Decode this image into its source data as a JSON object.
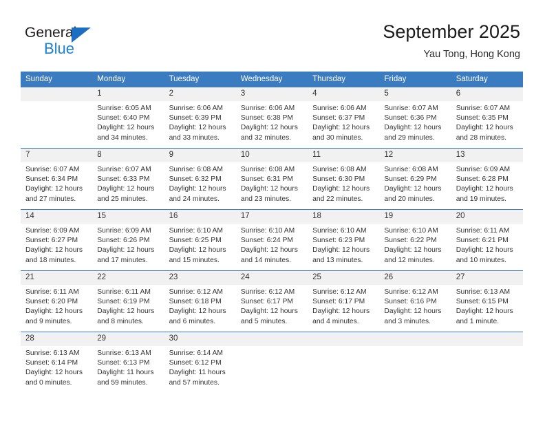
{
  "brand": {
    "name_part1": "General",
    "name_part2": "Blue",
    "accent_color": "#1b7fd4",
    "triangle_color": "#1b6ec2"
  },
  "header": {
    "title": "September 2025",
    "subtitle": "Yau Tong, Hong Kong"
  },
  "calendar": {
    "header_color": "#3b7cc0",
    "daynum_band_color": "#f1f1f1",
    "weekdays": [
      "Sunday",
      "Monday",
      "Tuesday",
      "Wednesday",
      "Thursday",
      "Friday",
      "Saturday"
    ],
    "labels": {
      "sunrise": "Sunrise:",
      "sunset": "Sunset:",
      "daylight": "Daylight:"
    },
    "weeks": [
      [
        {
          "day": "",
          "sunrise": "",
          "sunset": "",
          "daylight": ""
        },
        {
          "day": "1",
          "sunrise": "Sunrise: 6:05 AM",
          "sunset": "Sunset: 6:40 PM",
          "daylight": "Daylight: 12 hours and 34 minutes."
        },
        {
          "day": "2",
          "sunrise": "Sunrise: 6:06 AM",
          "sunset": "Sunset: 6:39 PM",
          "daylight": "Daylight: 12 hours and 33 minutes."
        },
        {
          "day": "3",
          "sunrise": "Sunrise: 6:06 AM",
          "sunset": "Sunset: 6:38 PM",
          "daylight": "Daylight: 12 hours and 32 minutes."
        },
        {
          "day": "4",
          "sunrise": "Sunrise: 6:06 AM",
          "sunset": "Sunset: 6:37 PM",
          "daylight": "Daylight: 12 hours and 30 minutes."
        },
        {
          "day": "5",
          "sunrise": "Sunrise: 6:07 AM",
          "sunset": "Sunset: 6:36 PM",
          "daylight": "Daylight: 12 hours and 29 minutes."
        },
        {
          "day": "6",
          "sunrise": "Sunrise: 6:07 AM",
          "sunset": "Sunset: 6:35 PM",
          "daylight": "Daylight: 12 hours and 28 minutes."
        }
      ],
      [
        {
          "day": "7",
          "sunrise": "Sunrise: 6:07 AM",
          "sunset": "Sunset: 6:34 PM",
          "daylight": "Daylight: 12 hours and 27 minutes."
        },
        {
          "day": "8",
          "sunrise": "Sunrise: 6:07 AM",
          "sunset": "Sunset: 6:33 PM",
          "daylight": "Daylight: 12 hours and 25 minutes."
        },
        {
          "day": "9",
          "sunrise": "Sunrise: 6:08 AM",
          "sunset": "Sunset: 6:32 PM",
          "daylight": "Daylight: 12 hours and 24 minutes."
        },
        {
          "day": "10",
          "sunrise": "Sunrise: 6:08 AM",
          "sunset": "Sunset: 6:31 PM",
          "daylight": "Daylight: 12 hours and 23 minutes."
        },
        {
          "day": "11",
          "sunrise": "Sunrise: 6:08 AM",
          "sunset": "Sunset: 6:30 PM",
          "daylight": "Daylight: 12 hours and 22 minutes."
        },
        {
          "day": "12",
          "sunrise": "Sunrise: 6:08 AM",
          "sunset": "Sunset: 6:29 PM",
          "daylight": "Daylight: 12 hours and 20 minutes."
        },
        {
          "day": "13",
          "sunrise": "Sunrise: 6:09 AM",
          "sunset": "Sunset: 6:28 PM",
          "daylight": "Daylight: 12 hours and 19 minutes."
        }
      ],
      [
        {
          "day": "14",
          "sunrise": "Sunrise: 6:09 AM",
          "sunset": "Sunset: 6:27 PM",
          "daylight": "Daylight: 12 hours and 18 minutes."
        },
        {
          "day": "15",
          "sunrise": "Sunrise: 6:09 AM",
          "sunset": "Sunset: 6:26 PM",
          "daylight": "Daylight: 12 hours and 17 minutes."
        },
        {
          "day": "16",
          "sunrise": "Sunrise: 6:10 AM",
          "sunset": "Sunset: 6:25 PM",
          "daylight": "Daylight: 12 hours and 15 minutes."
        },
        {
          "day": "17",
          "sunrise": "Sunrise: 6:10 AM",
          "sunset": "Sunset: 6:24 PM",
          "daylight": "Daylight: 12 hours and 14 minutes."
        },
        {
          "day": "18",
          "sunrise": "Sunrise: 6:10 AM",
          "sunset": "Sunset: 6:23 PM",
          "daylight": "Daylight: 12 hours and 13 minutes."
        },
        {
          "day": "19",
          "sunrise": "Sunrise: 6:10 AM",
          "sunset": "Sunset: 6:22 PM",
          "daylight": "Daylight: 12 hours and 12 minutes."
        },
        {
          "day": "20",
          "sunrise": "Sunrise: 6:11 AM",
          "sunset": "Sunset: 6:21 PM",
          "daylight": "Daylight: 12 hours and 10 minutes."
        }
      ],
      [
        {
          "day": "21",
          "sunrise": "Sunrise: 6:11 AM",
          "sunset": "Sunset: 6:20 PM",
          "daylight": "Daylight: 12 hours and 9 minutes."
        },
        {
          "day": "22",
          "sunrise": "Sunrise: 6:11 AM",
          "sunset": "Sunset: 6:19 PM",
          "daylight": "Daylight: 12 hours and 8 minutes."
        },
        {
          "day": "23",
          "sunrise": "Sunrise: 6:12 AM",
          "sunset": "Sunset: 6:18 PM",
          "daylight": "Daylight: 12 hours and 6 minutes."
        },
        {
          "day": "24",
          "sunrise": "Sunrise: 6:12 AM",
          "sunset": "Sunset: 6:17 PM",
          "daylight": "Daylight: 12 hours and 5 minutes."
        },
        {
          "day": "25",
          "sunrise": "Sunrise: 6:12 AM",
          "sunset": "Sunset: 6:17 PM",
          "daylight": "Daylight: 12 hours and 4 minutes."
        },
        {
          "day": "26",
          "sunrise": "Sunrise: 6:12 AM",
          "sunset": "Sunset: 6:16 PM",
          "daylight": "Daylight: 12 hours and 3 minutes."
        },
        {
          "day": "27",
          "sunrise": "Sunrise: 6:13 AM",
          "sunset": "Sunset: 6:15 PM",
          "daylight": "Daylight: 12 hours and 1 minute."
        }
      ],
      [
        {
          "day": "28",
          "sunrise": "Sunrise: 6:13 AM",
          "sunset": "Sunset: 6:14 PM",
          "daylight": "Daylight: 12 hours and 0 minutes."
        },
        {
          "day": "29",
          "sunrise": "Sunrise: 6:13 AM",
          "sunset": "Sunset: 6:13 PM",
          "daylight": "Daylight: 11 hours and 59 minutes."
        },
        {
          "day": "30",
          "sunrise": "Sunrise: 6:14 AM",
          "sunset": "Sunset: 6:12 PM",
          "daylight": "Daylight: 11 hours and 57 minutes."
        },
        {
          "day": "",
          "sunrise": "",
          "sunset": "",
          "daylight": ""
        },
        {
          "day": "",
          "sunrise": "",
          "sunset": "",
          "daylight": ""
        },
        {
          "day": "",
          "sunrise": "",
          "sunset": "",
          "daylight": ""
        },
        {
          "day": "",
          "sunrise": "",
          "sunset": "",
          "daylight": ""
        }
      ]
    ]
  }
}
